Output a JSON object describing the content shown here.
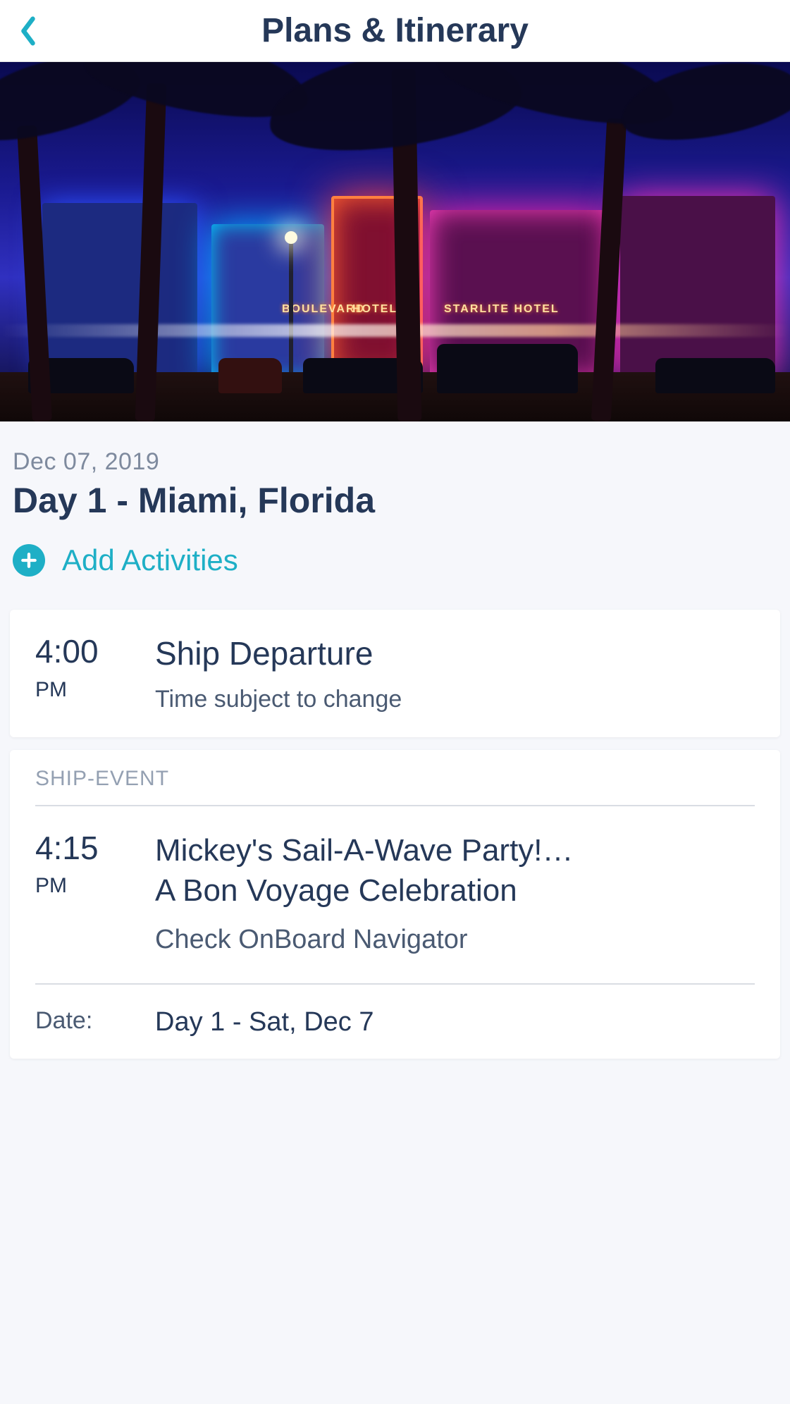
{
  "header": {
    "title": "Plans & Itinerary"
  },
  "hero": {
    "sign1": "BOULEVARD",
    "sign2": "HOTEL",
    "sign3": "STARLITE HOTEL"
  },
  "day": {
    "date": "Dec 07, 2019",
    "title": "Day 1 - Miami, Florida",
    "add_label": "Add Activities"
  },
  "events": [
    {
      "time": "4:00",
      "ampm": "PM",
      "title": "Ship Departure",
      "subtitle": "Time subject to change"
    },
    {
      "section": "SHIP-EVENT",
      "time": "4:15",
      "ampm": "PM",
      "title_line1": "Mickey's Sail-A-Wave Party!…",
      "title_line2": "A Bon Voyage Celebration",
      "location": "Check OnBoard Navigator",
      "meta": {
        "date_label": "Date:",
        "date_value": "Day 1 - Sat, Dec 7"
      }
    }
  ]
}
